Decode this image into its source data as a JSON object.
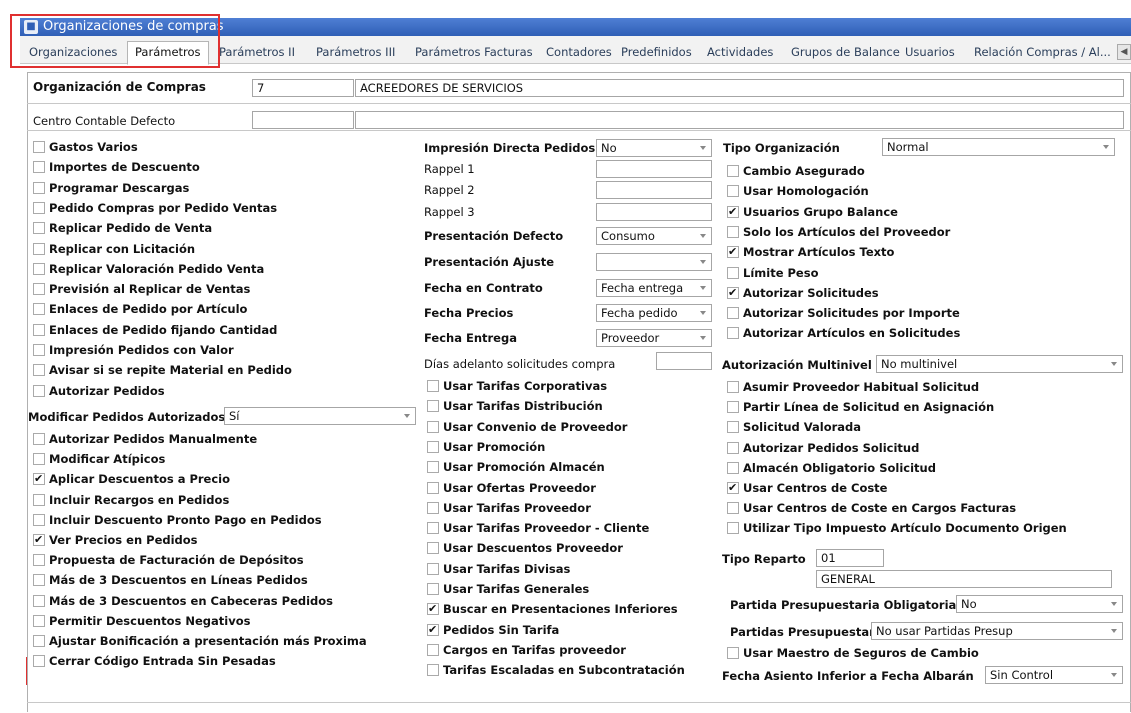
{
  "window": {
    "title": "Organizaciones de compras",
    "icon": "app-icon"
  },
  "tabs": [
    "Organizaciones",
    "Parámetros",
    "Parámetros II",
    "Parámetros III",
    "Parámetros Facturas",
    "Contadores",
    "Predefinidos",
    "Actividades",
    "Grupos de Balance",
    "Usuarios",
    "Relación Compras / Al..."
  ],
  "active_tab": "Parámetros",
  "org": {
    "label": "Organización de Compras",
    "code": "7",
    "name": "ACREEDORES DE SERVICIOS"
  },
  "centro": {
    "label": "Centro Contable Defecto",
    "code": "",
    "name": ""
  },
  "col1": [
    {
      "label": "Gastos Varios",
      "checked": false
    },
    {
      "label": "Importes de Descuento",
      "checked": false
    },
    {
      "label": "Programar Descargas",
      "checked": false
    },
    {
      "label": "Pedido Compras por Pedido Ventas",
      "checked": false
    },
    {
      "label": "Replicar Pedido de Venta",
      "checked": false
    },
    {
      "label": "Replicar con Licitación",
      "checked": false
    },
    {
      "label": "Replicar Valoración Pedido Venta",
      "checked": false
    },
    {
      "label": "Previsión al Replicar de Ventas",
      "checked": false
    },
    {
      "label": "Enlaces de Pedido por Artículo",
      "checked": false
    },
    {
      "label": "Enlaces de Pedido fijando Cantidad",
      "checked": false
    },
    {
      "label": "Impresión Pedidos con Valor",
      "checked": false
    },
    {
      "label": "Avisar si se repite Material en Pedido",
      "checked": false
    },
    {
      "label": "Autorizar Pedidos",
      "checked": false
    }
  ],
  "modificar": {
    "label": "Modificar Pedidos Autorizados",
    "value": "Sí"
  },
  "col1b": [
    {
      "label": "Autorizar Pedidos Manualmente",
      "checked": false
    },
    {
      "label": "Modificar Atípicos",
      "checked": false
    },
    {
      "label": "Aplicar Descuentos a Precio",
      "checked": true
    },
    {
      "label": "Incluir Recargos en Pedidos",
      "checked": false
    },
    {
      "label": "Incluir Descuento Pronto Pago en Pedidos",
      "checked": false
    },
    {
      "label": "Ver Precios en Pedidos",
      "checked": true
    },
    {
      "label": "Propuesta de Facturación de Depósitos",
      "checked": false
    },
    {
      "label": "Más de 3 Descuentos en Líneas Pedidos",
      "checked": false
    },
    {
      "label": "Más de 3 Descuentos en Cabeceras Pedidos",
      "checked": false
    },
    {
      "label": "Permitir Descuentos Negativos",
      "checked": false
    },
    {
      "label": "Ajustar Bonificación a presentación más Proxima",
      "checked": false
    },
    {
      "label": "Cerrar Código Entrada Sin Pesadas",
      "checked": false
    }
  ],
  "col2_fields": [
    {
      "label": "Impresión Directa Pedidos",
      "value": "No",
      "bold": true,
      "dropdown": true
    },
    {
      "label": "Rappel 1",
      "value": "",
      "bold": false,
      "dropdown": false
    },
    {
      "label": "Rappel 2",
      "value": "",
      "bold": false,
      "dropdown": false
    },
    {
      "label": "Rappel 3",
      "value": "",
      "bold": false,
      "dropdown": false
    },
    {
      "label": "Presentación Defecto",
      "value": "Consumo",
      "bold": true,
      "dropdown": true
    },
    {
      "label": "Presentación Ajuste",
      "value": "",
      "bold": true,
      "dropdown": true
    },
    {
      "label": "Fecha en Contrato",
      "value": "Fecha entrega",
      "bold": true,
      "dropdown": true
    },
    {
      "label": "Fecha Precios",
      "value": "Fecha pedido",
      "bold": true,
      "dropdown": true
    },
    {
      "label": "Fecha Entrega",
      "value": "Proveedor",
      "bold": true,
      "dropdown": true
    }
  ],
  "dias": {
    "label": "Días adelanto solicitudes compra",
    "value": ""
  },
  "col2_checks": [
    {
      "label": "Usar Tarifas Corporativas",
      "checked": false
    },
    {
      "label": "Usar Tarifas Distribución",
      "checked": false
    },
    {
      "label": "Usar Convenio de Proveedor",
      "checked": false
    },
    {
      "label": "Usar Promoción",
      "checked": false
    },
    {
      "label": "Usar Promoción Almacén",
      "checked": false
    },
    {
      "label": "Usar Ofertas Proveedor",
      "checked": false
    },
    {
      "label": "Usar Tarifas Proveedor",
      "checked": false
    },
    {
      "label": "Usar Tarifas Proveedor - Cliente",
      "checked": false
    },
    {
      "label": "Usar Descuentos Proveedor",
      "checked": false
    },
    {
      "label": "Usar Tarifas Divisas",
      "checked": false
    },
    {
      "label": "Usar Tarifas Generales",
      "checked": false
    },
    {
      "label": "Buscar en Presentaciones Inferiores",
      "checked": true
    },
    {
      "label": "Pedidos Sin Tarifa",
      "checked": true
    },
    {
      "label": "Cargos en Tarifas proveedor",
      "checked": false
    },
    {
      "label": "Tarifas Escaladas en Subcontratación",
      "checked": false
    }
  ],
  "tipo_org": {
    "label": "Tipo Organización",
    "value": "Normal"
  },
  "col3a": [
    {
      "label": "Cambio Asegurado",
      "checked": false
    },
    {
      "label": "Usar Homologación",
      "checked": false
    },
    {
      "label": "Usuarios Grupo Balance",
      "checked": true
    },
    {
      "label": "Solo los Artículos del Proveedor",
      "checked": false
    },
    {
      "label": "Mostrar Artículos Texto",
      "checked": true
    },
    {
      "label": "Límite Peso",
      "checked": false
    },
    {
      "label": "Autorizar Solicitudes",
      "checked": true
    },
    {
      "label": "Autorizar Solicitudes por Importe",
      "checked": false
    },
    {
      "label": "Autorizar Artículos en Solicitudes",
      "checked": false
    }
  ],
  "multinivel": {
    "label": "Autorización Multinivel",
    "value": "No multinivel"
  },
  "col3b": [
    {
      "label": "Asumir Proveedor Habitual Solicitud",
      "checked": false
    },
    {
      "label": "Partir Línea de Solicitud en Asignación",
      "checked": false
    },
    {
      "label": "Solicitud Valorada",
      "checked": false
    },
    {
      "label": "Autorizar Pedidos Solicitud",
      "checked": false
    },
    {
      "label": "Almacén Obligatorio Solicitud",
      "checked": false
    },
    {
      "label": "Usar Centros de Coste",
      "checked": true
    },
    {
      "label": "Usar Centros de Coste en Cargos Facturas",
      "checked": false
    },
    {
      "label": "Utilizar Tipo Impuesto Artículo Documento Origen",
      "checked": false
    }
  ],
  "reparto": {
    "label": "Tipo Reparto",
    "code": "01",
    "name": "GENERAL"
  },
  "partida": {
    "label": "Partida Presupuestaria Obligatoria",
    "value": "No"
  },
  "partidas": {
    "label": "Partidas Presupuestar",
    "value": "No usar Partidas Presup"
  },
  "seguros": {
    "label": "Usar Maestro de Seguros de Cambio",
    "checked": false
  },
  "fecha_asiento": {
    "label": "Fecha Asiento Inferior a Fecha Albarán",
    "value": "Sin Control"
  }
}
